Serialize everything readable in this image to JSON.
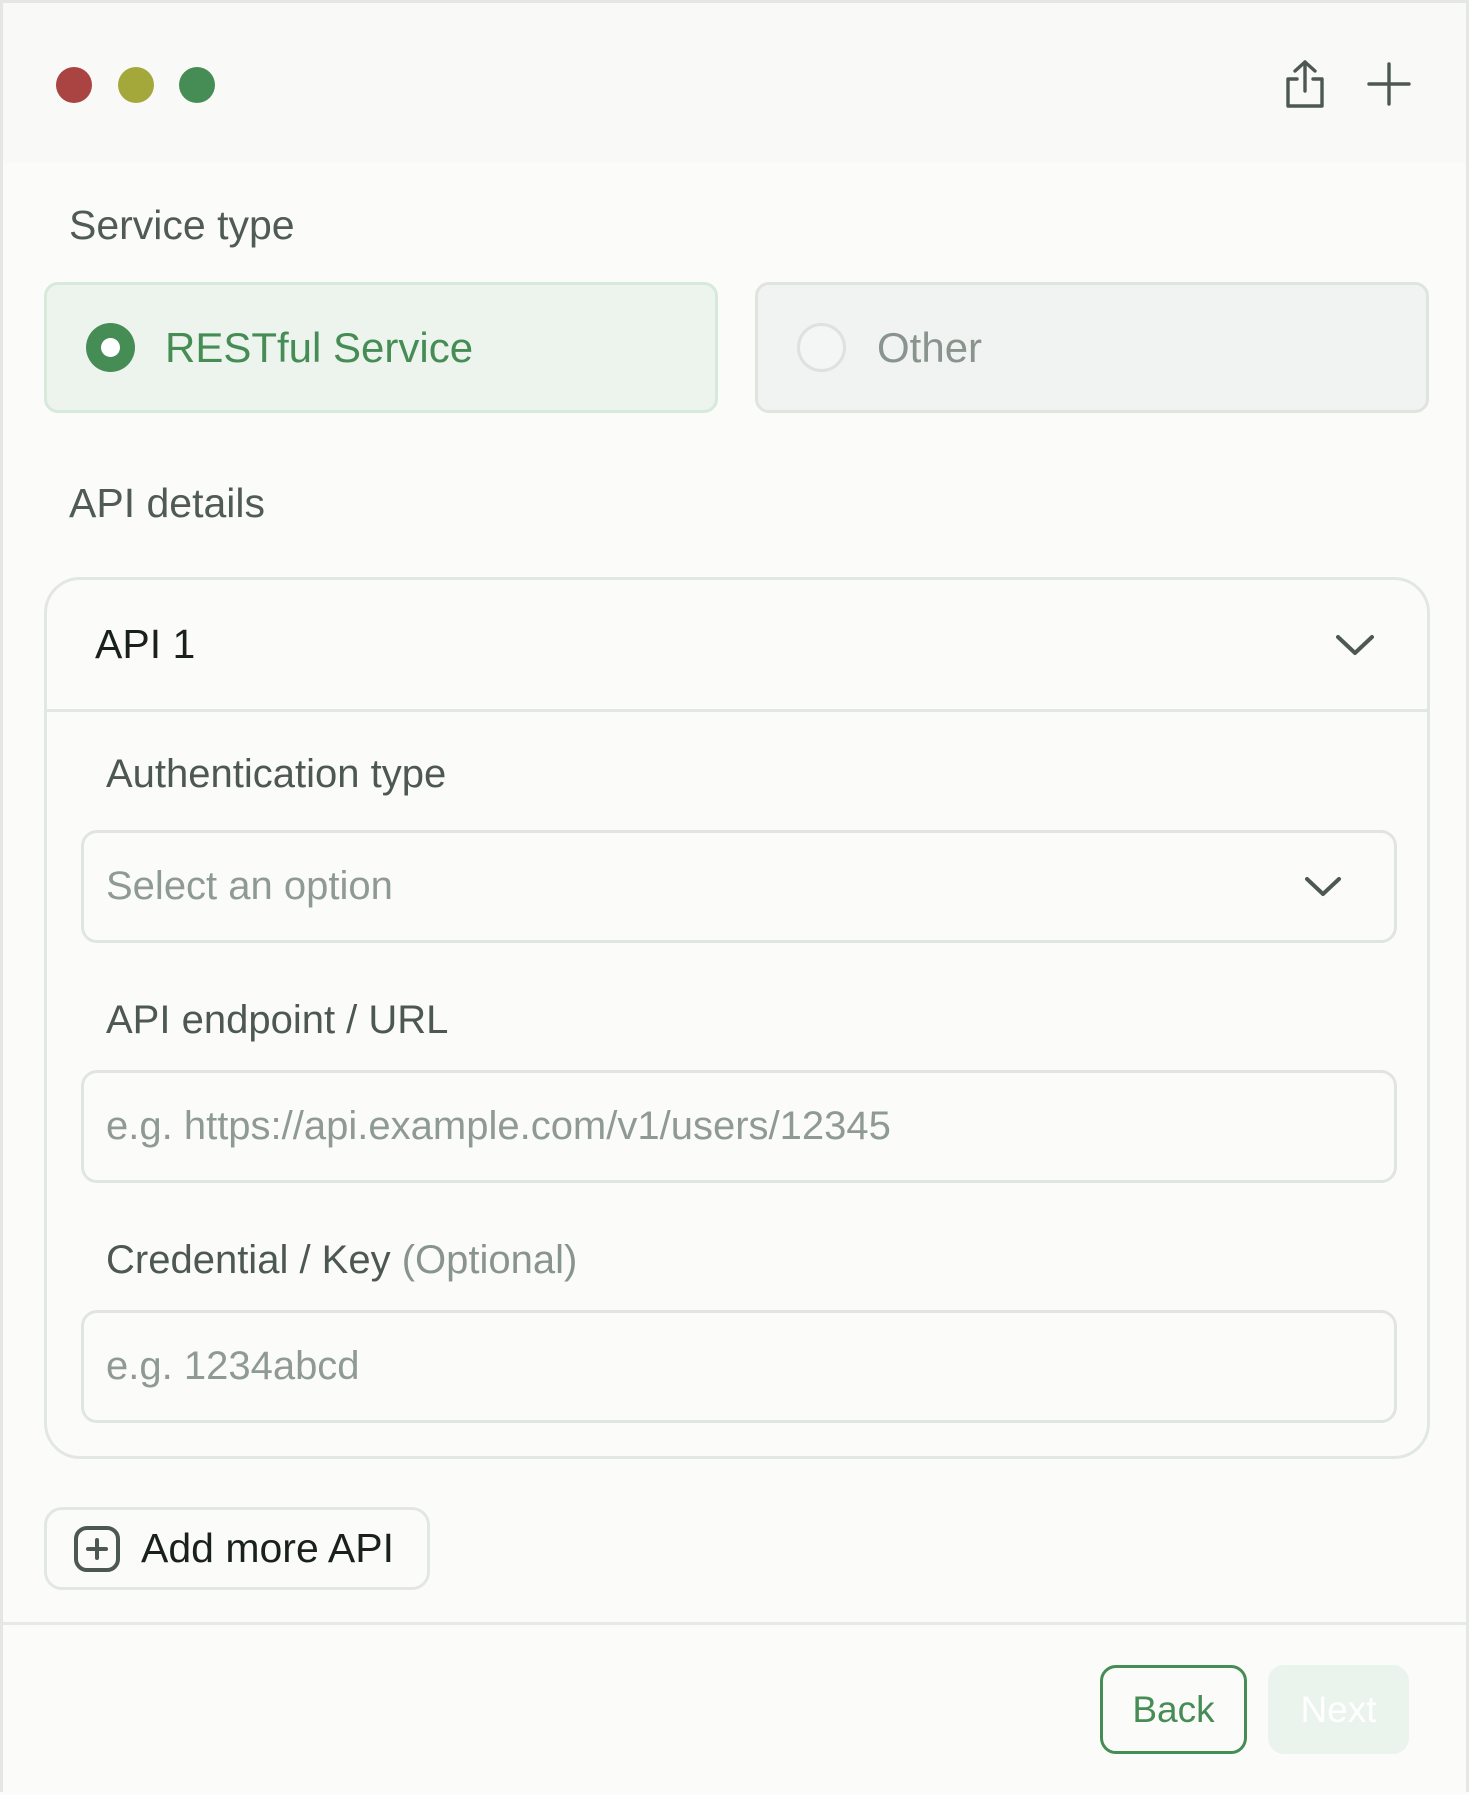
{
  "window": {
    "controls": [
      "close",
      "minimize",
      "maximize"
    ],
    "actions": {
      "share_icon": "share-icon",
      "add_icon": "plus-icon"
    }
  },
  "service_type": {
    "label": "Service type",
    "options": [
      {
        "label": "RESTful Service",
        "selected": true
      },
      {
        "label": "Other",
        "selected": false
      }
    ]
  },
  "api_details": {
    "label": "API details",
    "apis": [
      {
        "title": "API 1",
        "expanded": true,
        "auth_type": {
          "label": "Authentication type",
          "placeholder": "Select an option"
        },
        "endpoint": {
          "label": "API endpoint / URL",
          "placeholder": "e.g. https://api.example.com/v1/users/12345"
        },
        "credential": {
          "label": "Credential / Key",
          "optional_tag": "(Optional)",
          "placeholder": "e.g. 1234abcd"
        }
      }
    ],
    "add_more_label": "Add more API"
  },
  "footer": {
    "back_label": "Back",
    "next_label": "Next",
    "next_disabled": true
  },
  "colors": {
    "accent": "#468c55",
    "selected_bg": "#edf4ee",
    "close": "#a94442",
    "minimize": "#a4a73a",
    "maximize": "#468c55"
  }
}
